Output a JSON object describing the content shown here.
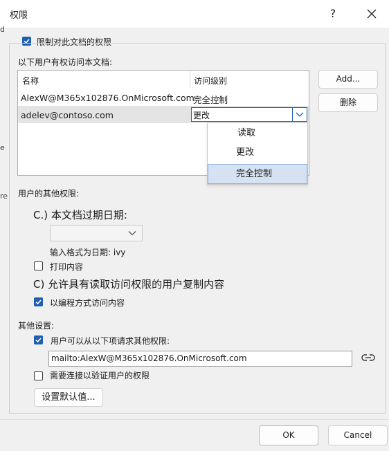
{
  "window": {
    "title": "权限",
    "help_label": "?",
    "close_icon": "close-icon"
  },
  "background_fragments": [
    "d",
    "e",
    "re"
  ],
  "restrict": {
    "label": "限制对此文档的权限",
    "checked": true
  },
  "users_section": {
    "label": "以下用户有权访问本文档:",
    "columns": [
      "名称",
      "访问级别"
    ],
    "rows": [
      {
        "name": "AlexW@M365x102876.OnMicrosoft.com",
        "level": "完全控制"
      },
      {
        "name": "adelev@contoso.com",
        "level": "更改"
      }
    ],
    "dropdown_options": [
      "读取",
      "更改",
      "完全控制"
    ],
    "dropdown_selected": "完全控制"
  },
  "buttons": {
    "add": "Add...",
    "delete": "删除",
    "defaults": "设置默认值...",
    "ok": "OK",
    "cancel": "Cancel"
  },
  "other_permissions": {
    "label": "用户的其他权限:",
    "expire_label": "C.) 本文档过期日期:",
    "date_format_hint": "输入格式为日期: ivy",
    "print": {
      "label": "打印内容",
      "checked": false
    },
    "copy_label": "C) 允许具有读取访问权限的用户复制内容",
    "programmatic": {
      "label": "以编程方式访问内容",
      "checked": true
    }
  },
  "other_settings": {
    "label": "其他设置:",
    "request": {
      "label": "用户可以从以下项请求其他权限:",
      "checked": true
    },
    "email_value": "mailto:AlexW@M365x102876.OnMicrosoft.com",
    "verify": {
      "label": "需要连接以验证用户的权限",
      "checked": false
    }
  }
}
